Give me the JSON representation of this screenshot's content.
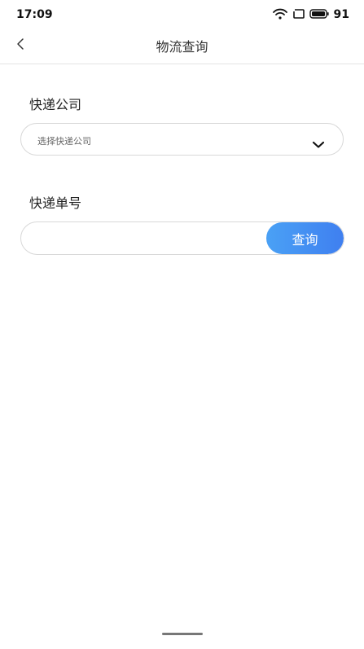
{
  "status_bar": {
    "time": "17:09",
    "battery": "91",
    "icons": [
      "wifi-icon",
      "screen-icon",
      "battery-icon"
    ]
  },
  "nav": {
    "back_icon": "chevron-left-icon",
    "title": "物流查询"
  },
  "form": {
    "company_label": "快递公司",
    "company_placeholder": "选择快递公司",
    "company_chevron_icon": "chevron-down-icon",
    "tracking_label": "快递单号",
    "tracking_value": "",
    "query_button_label": "查询"
  },
  "colors": {
    "button_gradient_start": "#4aa1f5",
    "button_gradient_end": "#3f7ff0",
    "border": "#d8d8d8",
    "background": "#ffffff"
  }
}
